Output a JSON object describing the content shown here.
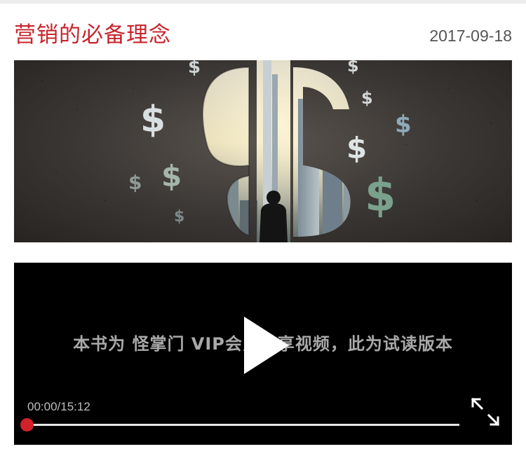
{
  "article": {
    "title": "营销的必备理念",
    "date": "2017-09-18"
  },
  "banner": {
    "image_icon": "dollar-sign-cityscape-image"
  },
  "video": {
    "overlay_text": "本书为 怪掌门 VIP会员专享视频，此为试读版本",
    "time_display": "00:00/15:12",
    "progress": 0,
    "play_icon": "play-icon",
    "fullscreen_icon": "fullscreen-icon"
  },
  "colors": {
    "accent": "#c8242c",
    "progress_handle": "#d1222a",
    "video_bg": "#000000"
  }
}
